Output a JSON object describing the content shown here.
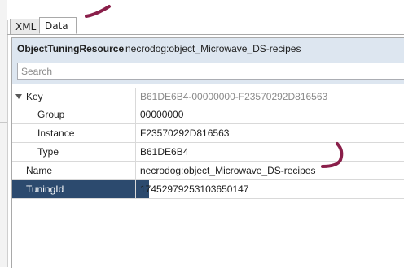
{
  "tabs": [
    {
      "label": "XML"
    },
    {
      "label": "Data"
    }
  ],
  "header": {
    "title": "ObjectTuningResource",
    "name": "necrodog:object_Microwave_DS-recipes"
  },
  "search": {
    "placeholder": "Search",
    "value": ""
  },
  "rows": [
    {
      "name": "Key",
      "value": "B61DE6B4-00000000-F23570292D816563",
      "expanded": true
    },
    {
      "name": "Group",
      "value": "00000000"
    },
    {
      "name": "Instance",
      "value": "F23570292D816563"
    },
    {
      "name": "Type",
      "value": "B61DE6B4"
    },
    {
      "name": "Name",
      "value": "necrodog:object_Microwave_DS-recipes"
    },
    {
      "name": "TuningId",
      "value": "17452979253103650147",
      "selected": true
    }
  ],
  "colors": {
    "header_bg": "#dde6f0",
    "selected_bg": "#2c4a6e",
    "stroke": "#8a1f4a"
  }
}
